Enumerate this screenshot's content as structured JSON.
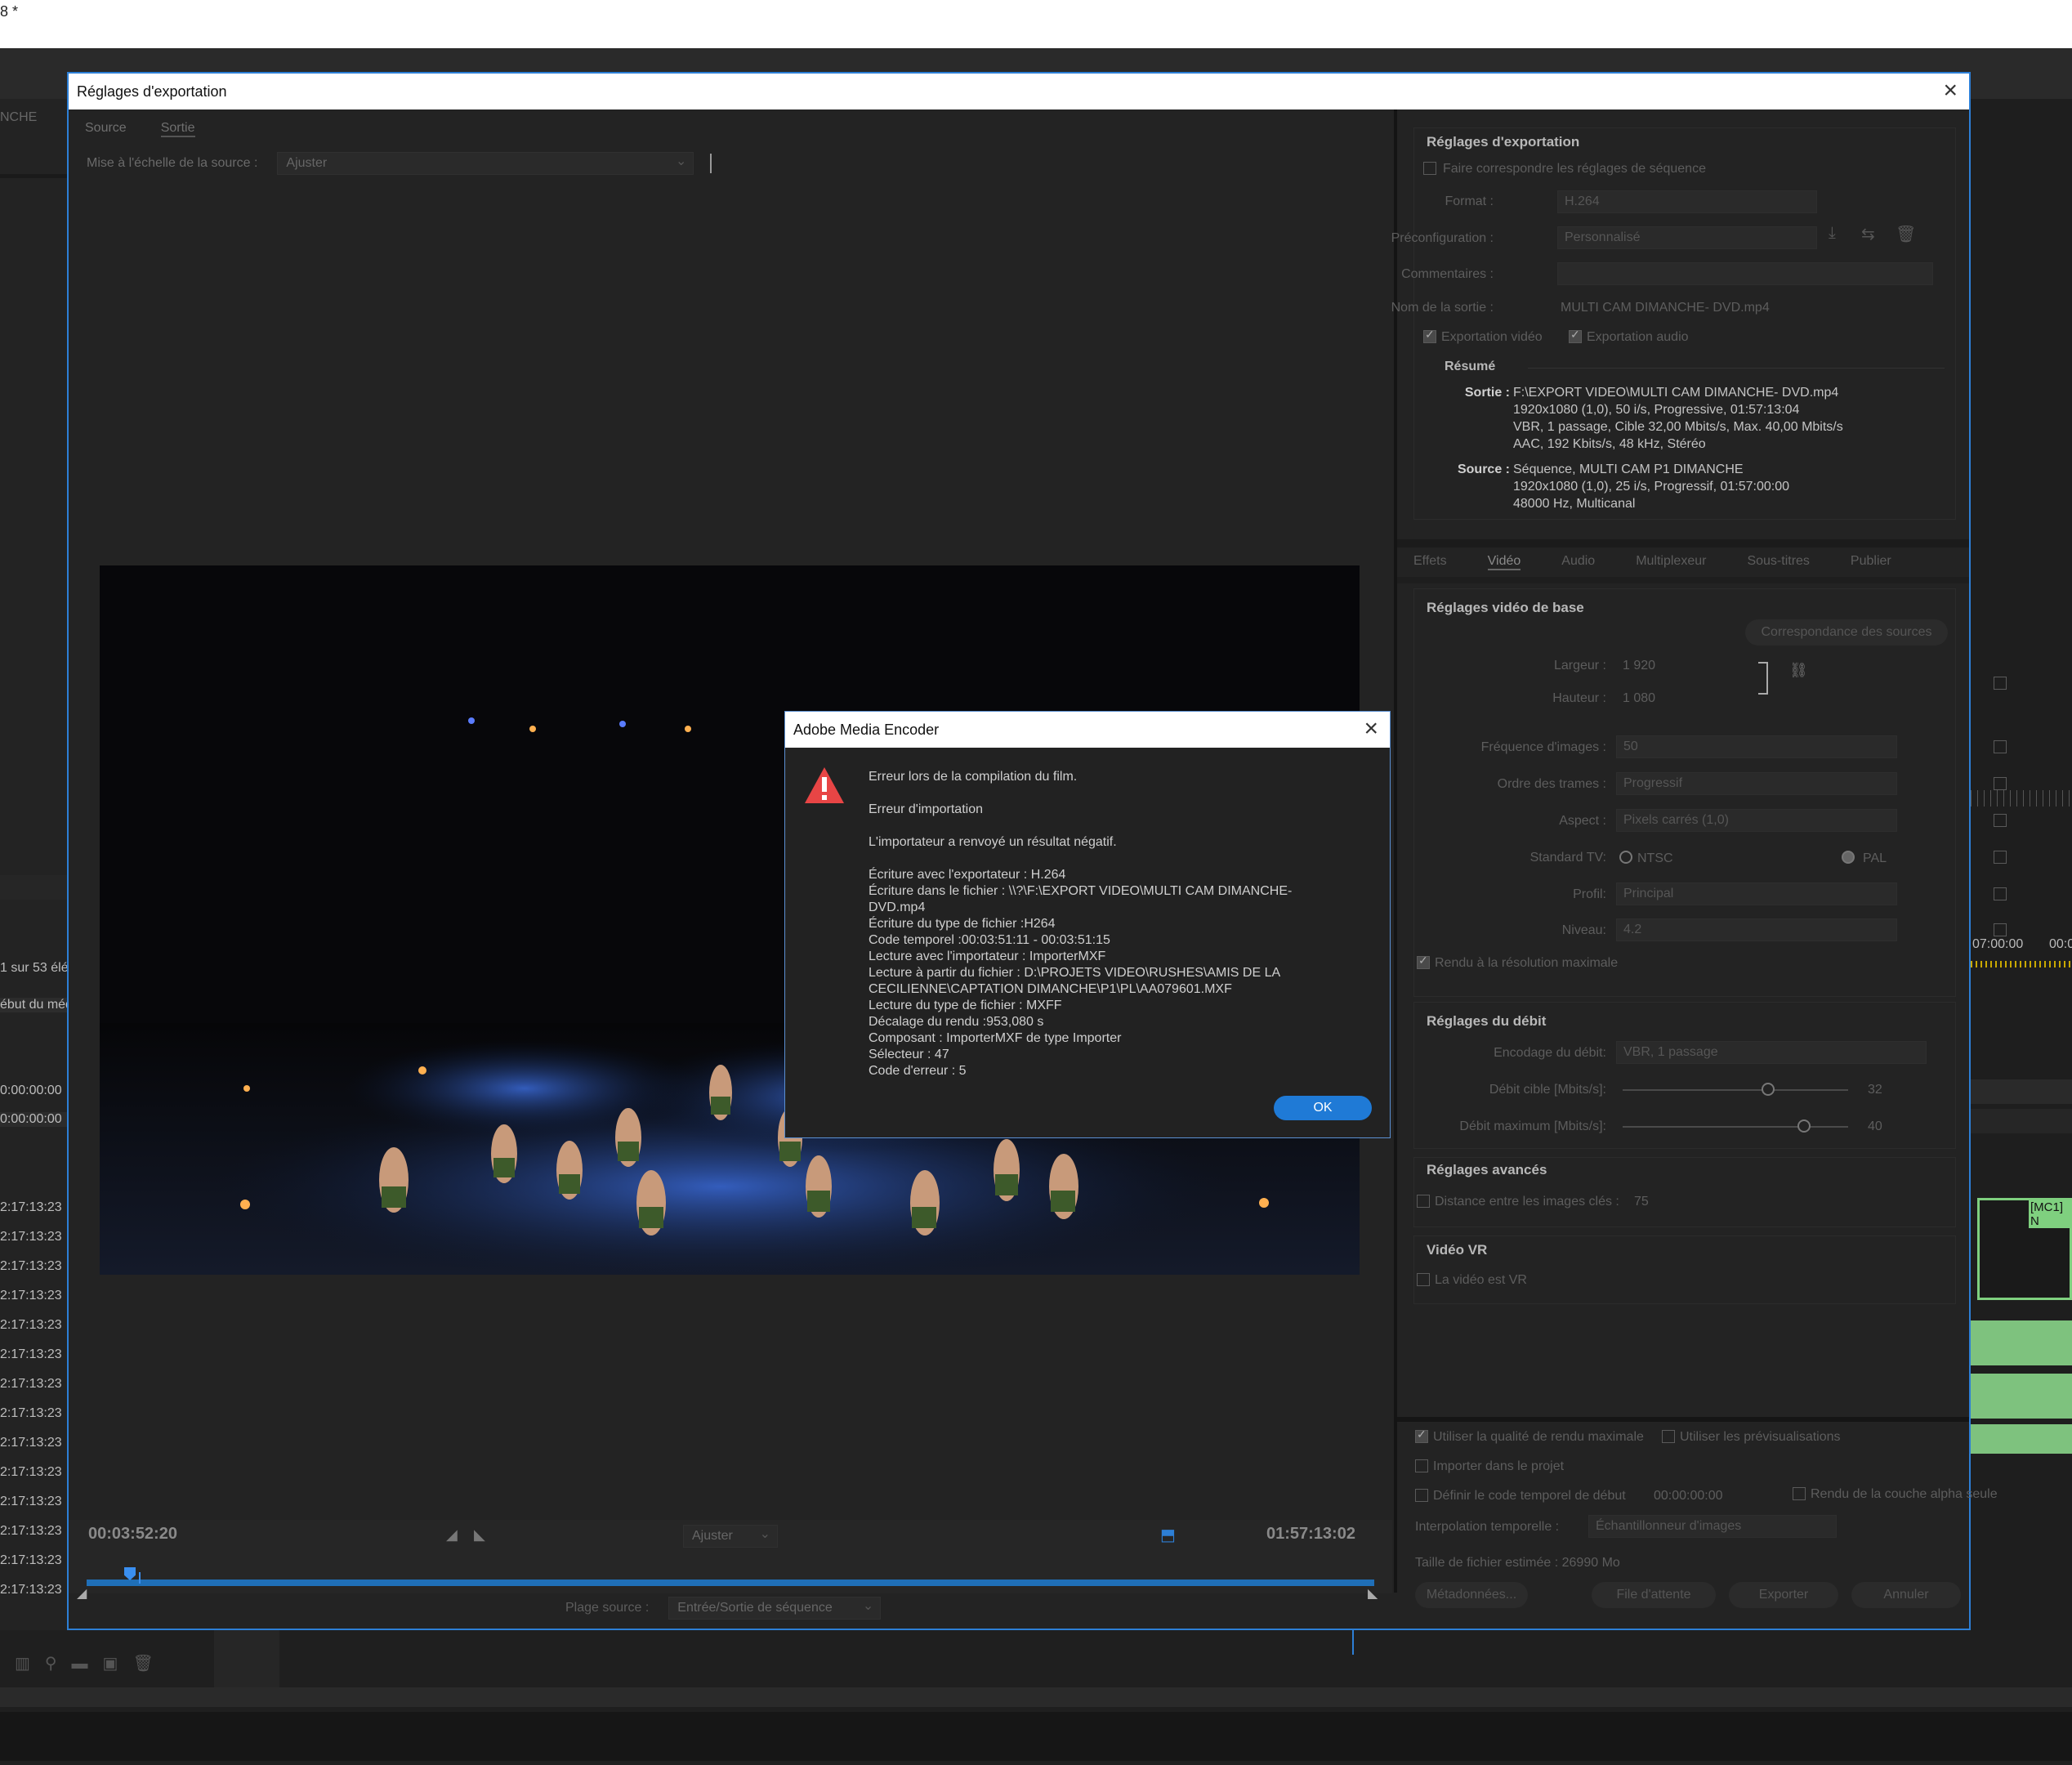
{
  "top_strip_text": "8 *",
  "left_panel": {
    "label_nche": "NCHE",
    "label_count": "1 sur 53 élé",
    "label_debut": "ébut du méd",
    "tc_a": "0:00:00:00",
    "tc_b": "0:00:00:00",
    "tc_rows": [
      "2:17:13:23",
      "2:17:13:23",
      "2:17:13:23",
      "2:17:13:23",
      "2:17:13:23",
      "2:17:13:23",
      "2:17:13:23",
      "2:17:13:23",
      "2:17:13:23",
      "2:17:13:23",
      "2:17:13:23",
      "2:17:13:23",
      "2:17:13:23",
      "2:17:13:23"
    ]
  },
  "right_bg": {
    "tc1": "07:00:00",
    "tc2": "00:0",
    "clip_label": "[MC1] N"
  },
  "export_window": {
    "title": "Réglages d'exportation",
    "tabs": [
      "Source",
      "Sortie"
    ],
    "scale_label": "Mise à l'échelle de la source :",
    "scale_value": "Ajuster",
    "current_tc": "00:03:52:20",
    "end_tc": "01:57:13:02",
    "fit_value": "Ajuster",
    "source_range_label": "Plage source :",
    "source_range_value": "Entrée/Sortie de séquence"
  },
  "export_settings": {
    "section_title": "Réglages d'exportation",
    "match_seq": "Faire correspondre les réglages de séquence",
    "format_label": "Format :",
    "format_value": "H.264",
    "preset_label": "Préconfiguration :",
    "preset_value": "Personnalisé",
    "comments_label": "Commentaires :",
    "output_name_label": "Nom de la sortie :",
    "output_name_value": "MULTI CAM DIMANCHE- DVD.mp4",
    "export_video": "Exportation vidéo",
    "export_audio": "Exportation audio",
    "summary_title": "Résumé",
    "sortie_label": "Sortie :",
    "sortie_lines": [
      "F:\\EXPORT VIDEO\\MULTI CAM DIMANCHE- DVD.mp4",
      "1920x1080 (1,0), 50 i/s, Progressive, 01:57:13:04",
      "VBR, 1 passage, Cible 32,00  Mbits/s, Max. 40,00  Mbits/s",
      "AAC, 192  Kbits/s, 48  kHz, Stéréo"
    ],
    "source_label": "Source :",
    "source_lines": [
      "Séquence, MULTI CAM P1 DIMANCHE",
      "1920x1080 (1,0), 25  i/s, Progressif, 01:57:00:00",
      "48000 Hz, Multicanal"
    ]
  },
  "settings_tabs": [
    "Effets",
    "Vidéo",
    "Audio",
    "Multiplexeur",
    "Sous-titres",
    "Publier"
  ],
  "basic_video": {
    "title": "Réglages vidéo de base",
    "match_source_btn": "Correspondance des sources",
    "width_label": "Largeur :",
    "width_value": "1 920",
    "height_label": "Hauteur :",
    "height_value": "1 080",
    "fps_label": "Fréquence d'images :",
    "fps_value": "50",
    "field_order_label": "Ordre des trames :",
    "field_order_value": "Progressif",
    "aspect_label": "Aspect :",
    "aspect_value": "Pixels carrés (1,0)",
    "tv_std_label": "Standard TV:",
    "ntsc": "NTSC",
    "pal": "PAL",
    "profile_label": "Profil:",
    "profile_value": "Principal",
    "level_label": "Niveau:",
    "level_value": "4.2",
    "max_res": "Rendu à la résolution maximale"
  },
  "bitrate": {
    "title": "Réglages du débit",
    "encoding_label": "Encodage du débit:",
    "encoding_value": "VBR, 1 passage",
    "target_label": "Débit cible [Mbits/s]:",
    "target_value": "32",
    "max_label": "Débit maximum [Mbits/s]:",
    "max_value": "40"
  },
  "advanced": {
    "title": "Réglages avancés",
    "keyframe": "Distance entre les images clés :",
    "keyframe_value": "75"
  },
  "vr": {
    "title": "Vidéo VR",
    "is_vr": "La vidéo est VR"
  },
  "footer": {
    "max_quality": "Utiliser la qualité de rendu maximale",
    "use_previews": "Utiliser les prévisualisations",
    "import_project": "Importer dans le projet",
    "set_start_tc": "Définir le code temporel de début",
    "start_tc_value": "00:00:00:00",
    "alpha_only": "Rendu de la couche alpha seule",
    "interp_label": "Interpolation temporelle :",
    "interp_value": "Échantillonneur d'images",
    "filesize": "Taille de fichier estimée :  26990 Mo",
    "btn_metadata": "Métadonnées...",
    "btn_queue": "File d'attente",
    "btn_export": "Exporter",
    "btn_cancel": "Annuler"
  },
  "dialog": {
    "title": "Adobe Media Encoder",
    "body": "Erreur lors de la compilation du film.\n\nErreur d'importation\n\nL'importateur a renvoyé un résultat négatif.\n\nÉcriture avec l'exportateur : H.264\nÉcriture dans le fichier : \\\\?\\F:\\EXPORT VIDEO\\MULTI CAM DIMANCHE-\nDVD.mp4\nÉcriture du type de fichier :H264\nCode temporel :00:03:51:11 - 00:03:51:15\nLecture avec l'importateur : ImporterMXF\nLecture à partir du fichier : D:\\PROJETS VIDEO\\RUSHES\\AMIS DE LA\nCECILIENNE\\CAPTATION DIMANCHE\\P1\\PL\\AA079601.MXF\nLecture du type de fichier : MXFF\nDécalage du rendu :953,080 s\nComposant : ImporterMXF de type Importer\nSélecteur : 47\nCode d'erreur : 5",
    "ok": "OK"
  }
}
